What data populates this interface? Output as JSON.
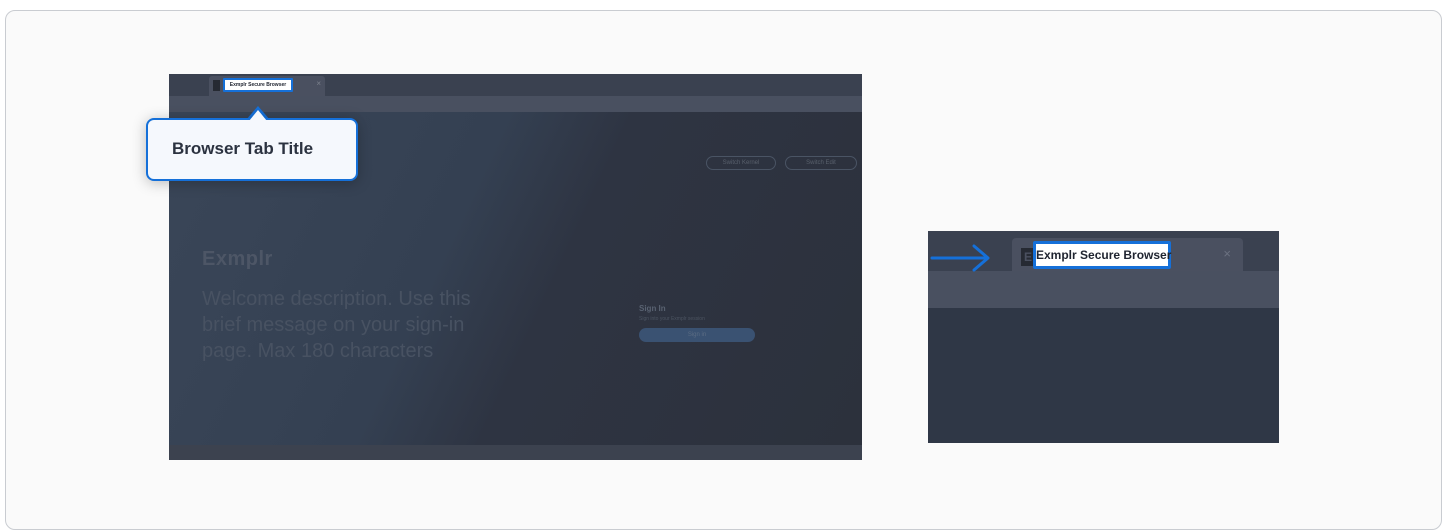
{
  "colors": {
    "accent": "#1570d9",
    "browser_dark": "#2f3746",
    "tabbar": "#3a4150"
  },
  "left_screenshot": {
    "tab_title": "Exmplr Secure Browser",
    "tab_close": "×",
    "buttons": [
      "Switch Kernel",
      "Switch Edit"
    ],
    "brand": "Exmplr",
    "welcome": "Welcome description. Use this brief message on your sign-in page. Max 180 characters",
    "signin": {
      "title": "Sign In",
      "subtitle": "Sign into your Exmplr session",
      "button": "Sign in"
    }
  },
  "callout": {
    "label": "Browser Tab Title"
  },
  "right_screenshot": {
    "favicon_letter": "E",
    "tab_title": "Exmplr Secure Browser",
    "tab_close": "×",
    "pointer_icon": "arrow-right-icon"
  }
}
